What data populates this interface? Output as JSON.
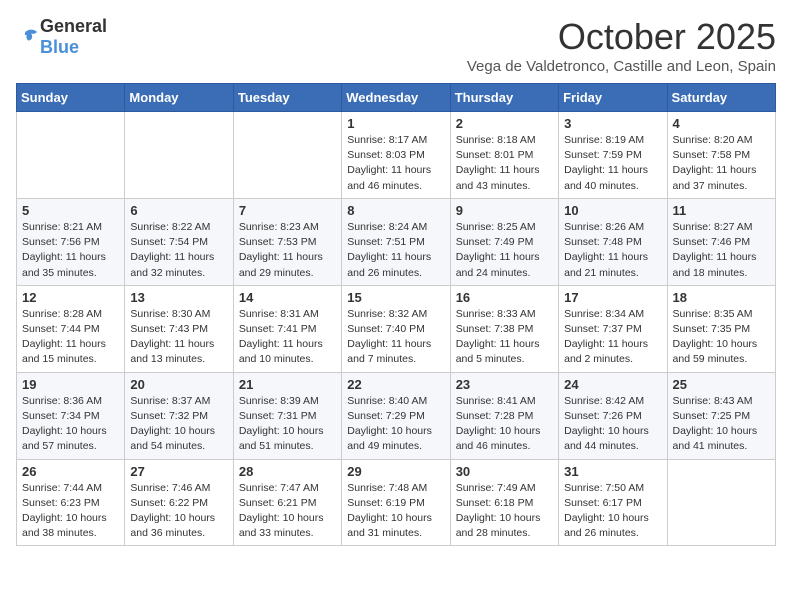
{
  "logo": {
    "general": "General",
    "blue": "Blue"
  },
  "header": {
    "month": "October 2025",
    "location": "Vega de Valdetronco, Castille and Leon, Spain"
  },
  "weekdays": [
    "Sunday",
    "Monday",
    "Tuesday",
    "Wednesday",
    "Thursday",
    "Friday",
    "Saturday"
  ],
  "weeks": [
    [
      {
        "day": "",
        "info": ""
      },
      {
        "day": "",
        "info": ""
      },
      {
        "day": "",
        "info": ""
      },
      {
        "day": "1",
        "info": "Sunrise: 8:17 AM\nSunset: 8:03 PM\nDaylight: 11 hours and 46 minutes."
      },
      {
        "day": "2",
        "info": "Sunrise: 8:18 AM\nSunset: 8:01 PM\nDaylight: 11 hours and 43 minutes."
      },
      {
        "day": "3",
        "info": "Sunrise: 8:19 AM\nSunset: 7:59 PM\nDaylight: 11 hours and 40 minutes."
      },
      {
        "day": "4",
        "info": "Sunrise: 8:20 AM\nSunset: 7:58 PM\nDaylight: 11 hours and 37 minutes."
      }
    ],
    [
      {
        "day": "5",
        "info": "Sunrise: 8:21 AM\nSunset: 7:56 PM\nDaylight: 11 hours and 35 minutes."
      },
      {
        "day": "6",
        "info": "Sunrise: 8:22 AM\nSunset: 7:54 PM\nDaylight: 11 hours and 32 minutes."
      },
      {
        "day": "7",
        "info": "Sunrise: 8:23 AM\nSunset: 7:53 PM\nDaylight: 11 hours and 29 minutes."
      },
      {
        "day": "8",
        "info": "Sunrise: 8:24 AM\nSunset: 7:51 PM\nDaylight: 11 hours and 26 minutes."
      },
      {
        "day": "9",
        "info": "Sunrise: 8:25 AM\nSunset: 7:49 PM\nDaylight: 11 hours and 24 minutes."
      },
      {
        "day": "10",
        "info": "Sunrise: 8:26 AM\nSunset: 7:48 PM\nDaylight: 11 hours and 21 minutes."
      },
      {
        "day": "11",
        "info": "Sunrise: 8:27 AM\nSunset: 7:46 PM\nDaylight: 11 hours and 18 minutes."
      }
    ],
    [
      {
        "day": "12",
        "info": "Sunrise: 8:28 AM\nSunset: 7:44 PM\nDaylight: 11 hours and 15 minutes."
      },
      {
        "day": "13",
        "info": "Sunrise: 8:30 AM\nSunset: 7:43 PM\nDaylight: 11 hours and 13 minutes."
      },
      {
        "day": "14",
        "info": "Sunrise: 8:31 AM\nSunset: 7:41 PM\nDaylight: 11 hours and 10 minutes."
      },
      {
        "day": "15",
        "info": "Sunrise: 8:32 AM\nSunset: 7:40 PM\nDaylight: 11 hours and 7 minutes."
      },
      {
        "day": "16",
        "info": "Sunrise: 8:33 AM\nSunset: 7:38 PM\nDaylight: 11 hours and 5 minutes."
      },
      {
        "day": "17",
        "info": "Sunrise: 8:34 AM\nSunset: 7:37 PM\nDaylight: 11 hours and 2 minutes."
      },
      {
        "day": "18",
        "info": "Sunrise: 8:35 AM\nSunset: 7:35 PM\nDaylight: 10 hours and 59 minutes."
      }
    ],
    [
      {
        "day": "19",
        "info": "Sunrise: 8:36 AM\nSunset: 7:34 PM\nDaylight: 10 hours and 57 minutes."
      },
      {
        "day": "20",
        "info": "Sunrise: 8:37 AM\nSunset: 7:32 PM\nDaylight: 10 hours and 54 minutes."
      },
      {
        "day": "21",
        "info": "Sunrise: 8:39 AM\nSunset: 7:31 PM\nDaylight: 10 hours and 51 minutes."
      },
      {
        "day": "22",
        "info": "Sunrise: 8:40 AM\nSunset: 7:29 PM\nDaylight: 10 hours and 49 minutes."
      },
      {
        "day": "23",
        "info": "Sunrise: 8:41 AM\nSunset: 7:28 PM\nDaylight: 10 hours and 46 minutes."
      },
      {
        "day": "24",
        "info": "Sunrise: 8:42 AM\nSunset: 7:26 PM\nDaylight: 10 hours and 44 minutes."
      },
      {
        "day": "25",
        "info": "Sunrise: 8:43 AM\nSunset: 7:25 PM\nDaylight: 10 hours and 41 minutes."
      }
    ],
    [
      {
        "day": "26",
        "info": "Sunrise: 7:44 AM\nSunset: 6:23 PM\nDaylight: 10 hours and 38 minutes."
      },
      {
        "day": "27",
        "info": "Sunrise: 7:46 AM\nSunset: 6:22 PM\nDaylight: 10 hours and 36 minutes."
      },
      {
        "day": "28",
        "info": "Sunrise: 7:47 AM\nSunset: 6:21 PM\nDaylight: 10 hours and 33 minutes."
      },
      {
        "day": "29",
        "info": "Sunrise: 7:48 AM\nSunset: 6:19 PM\nDaylight: 10 hours and 31 minutes."
      },
      {
        "day": "30",
        "info": "Sunrise: 7:49 AM\nSunset: 6:18 PM\nDaylight: 10 hours and 28 minutes."
      },
      {
        "day": "31",
        "info": "Sunrise: 7:50 AM\nSunset: 6:17 PM\nDaylight: 10 hours and 26 minutes."
      },
      {
        "day": "",
        "info": ""
      }
    ]
  ]
}
